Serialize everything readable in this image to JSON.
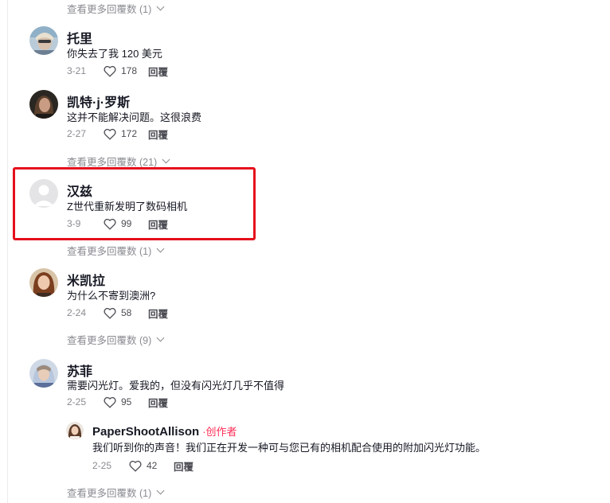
{
  "comments": [
    {
      "username": "托里",
      "text": "你失去了我 120 美元",
      "date": "3-21",
      "likes": "178",
      "reply": "回覆"
    },
    {
      "username": "凯特·j·罗斯",
      "text": "这并不能解决问题。这很浪费",
      "date": "2-27",
      "likes": "172",
      "reply": "回覆",
      "view_more": "查看更多回覆数 (21)"
    },
    {
      "username": "汉兹",
      "text": "Z世代重新发明了数码相机",
      "date": "3-9",
      "likes": "99",
      "reply": "回覆",
      "view_more": "查看更多回覆数 (1)"
    },
    {
      "username": "米凯拉",
      "text": "为什么不寄到澳洲?",
      "date": "2-24",
      "likes": "58",
      "reply": "回覆",
      "view_more": "查看更多回覆数 (9)"
    },
    {
      "username": "苏菲",
      "text": "需要闪光灯。爱我的，但没有闪光灯几乎不值得",
      "date": "2-25",
      "likes": "95",
      "reply": "回覆",
      "view_more": "查看更多回覆数 (1)",
      "reply_item": {
        "username": "PaperShootAllison",
        "badge": "·创作者",
        "text": "我们听到你的声音！我们正在开发一种可与您已有的相机配合使用的附加闪光灯功能。",
        "date": "2-25",
        "likes": "42",
        "reply": "回覆"
      }
    }
  ],
  "top_view_more": "查看更多回覆数 (1)",
  "colors": {
    "creator_badge": "#fe2c55",
    "highlight": "#e5101c",
    "muted": "#8a8b91"
  }
}
